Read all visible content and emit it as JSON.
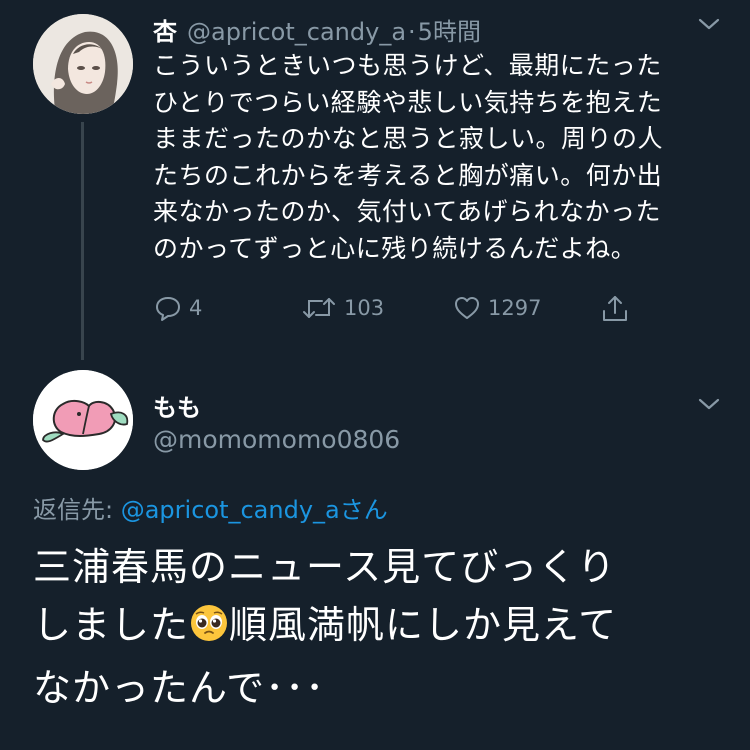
{
  "tweet1": {
    "name": "杏",
    "handle": "@apricot_candy_a",
    "separator": "·",
    "time": "5時間",
    "body_lines": [
      "こういうときいつも思うけど、最期にたった",
      "ひとりでつらい経験や悲しい気持ちを抱えた",
      "ままだったのかなと思うと寂しい。周りの人",
      "たちのこれからを考えると胸が痛い。何か出",
      "来なかったのか、気付いてあげられなかった",
      "のかってずっと心に残り続けるんだよね。"
    ],
    "replies": "4",
    "retweets": "103",
    "likes": "1297"
  },
  "tweet2": {
    "name": "もも",
    "handle": "@momomomo0806",
    "reply_prefix": "返信先: ",
    "reply_mention": "@apricot_candy_a",
    "reply_suffix": "さん",
    "body_line1": "三浦春馬のニュース見てびっくり",
    "body_line2_before_emoji": "しました",
    "body_line2_after_emoji": "順風満帆にしか見えて",
    "body_line3": "なかったんで･･･"
  },
  "colors": {
    "background": "#15202b",
    "muted": "#8899a6",
    "link": "#1b95e0",
    "thread_line": "#38444d"
  },
  "icons": [
    "chevron-down-icon",
    "reply-icon",
    "retweet-icon",
    "like-icon",
    "share-icon",
    "pleading-face-emoji"
  ]
}
